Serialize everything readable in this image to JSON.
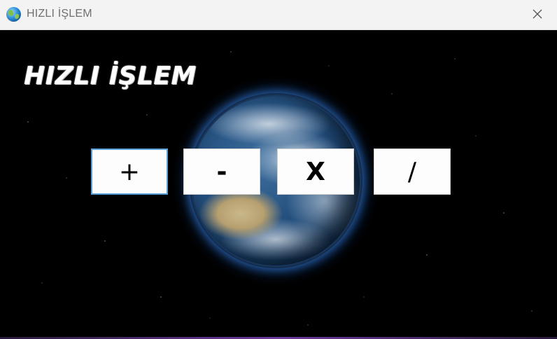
{
  "window": {
    "title": "HIZLI İŞLEM",
    "icon": "globe-icon",
    "close_icon": "close-icon"
  },
  "content": {
    "heading": "HIZLI İŞLEM",
    "background": "earth-in-space",
    "buttons": [
      {
        "label": "+",
        "focused": true
      },
      {
        "label": "-",
        "focused": false
      },
      {
        "label": "X",
        "focused": false
      },
      {
        "label": "/",
        "focused": false
      }
    ]
  },
  "colors": {
    "focus_border": "#5a9fd6",
    "titlebar_bg": "#f3f3f3"
  }
}
